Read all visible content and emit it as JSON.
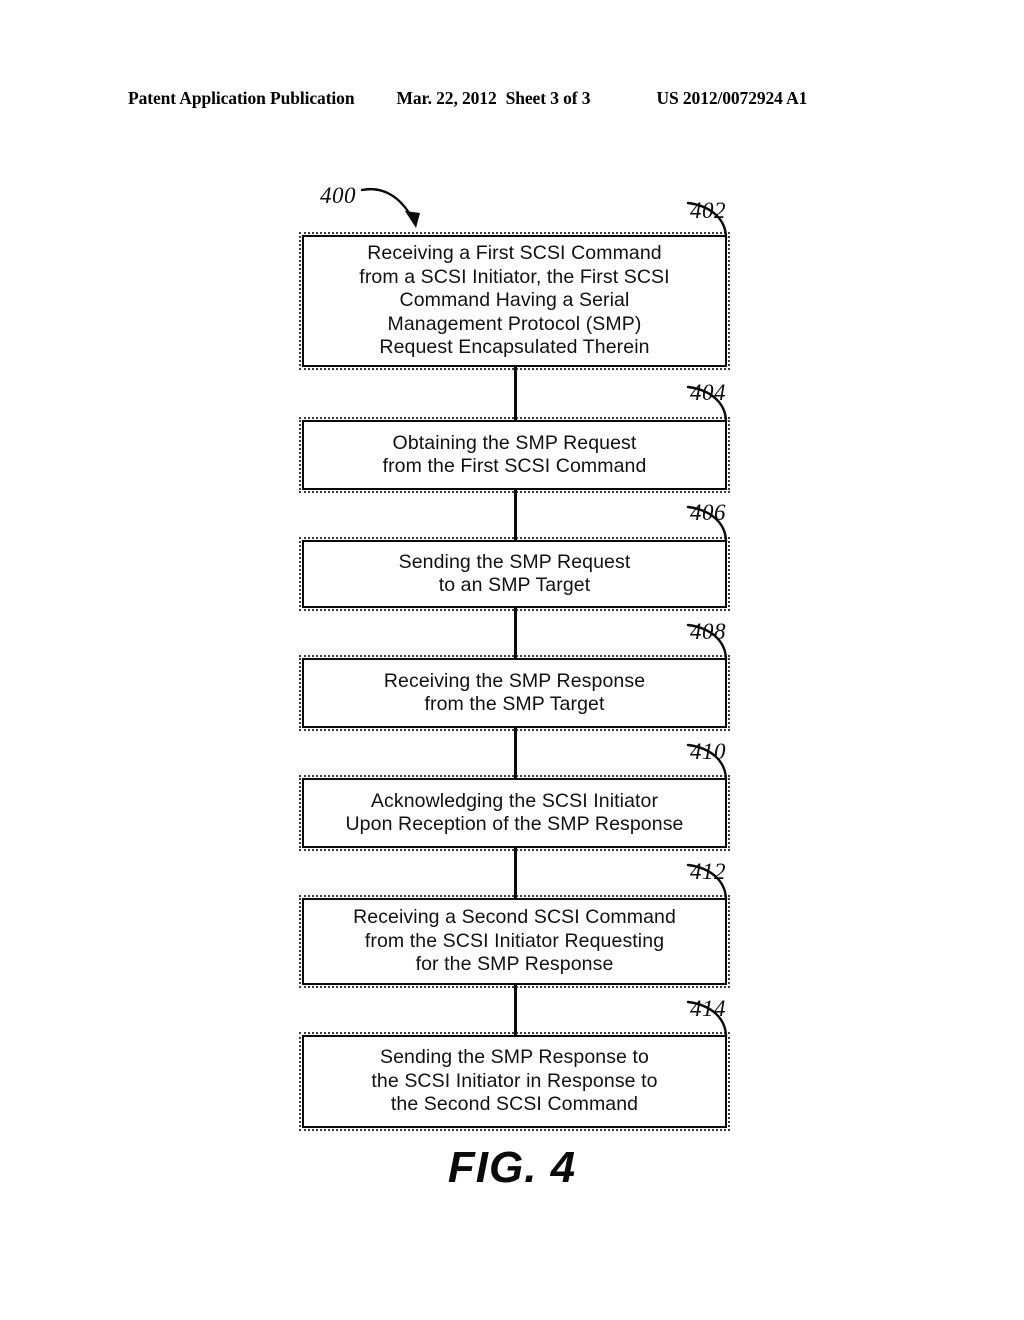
{
  "header": {
    "publication": "Patent Application Publication",
    "date": "Mar. 22, 2012",
    "sheet": "Sheet 3 of 3",
    "patent_number": "US 2012/0072924 A1"
  },
  "figure": {
    "flow_label": "400",
    "caption": "FIG. 4",
    "steps": [
      {
        "ref": "402",
        "text": "Receiving a First SCSI Command\nfrom a SCSI Initiator, the First SCSI\nCommand Having a Serial\nManagement Protocol (SMP)\nRequest Encapsulated Therein"
      },
      {
        "ref": "404",
        "text": "Obtaining the SMP Request\nfrom the First SCSI Command"
      },
      {
        "ref": "406",
        "text": "Sending the SMP Request\nto an SMP Target"
      },
      {
        "ref": "408",
        "text": "Receiving the SMP Response\nfrom the SMP Target"
      },
      {
        "ref": "410",
        "text": "Acknowledging the SCSI Initiator\nUpon Reception of the SMP Response"
      },
      {
        "ref": "412",
        "text": "Receiving a Second SCSI Command\nfrom the SCSI Initiator Requesting\nfor the SMP Response"
      },
      {
        "ref": "414",
        "text": "Sending the SMP Response to\nthe SCSI Initiator in Response to\nthe Second SCSI Command"
      }
    ]
  },
  "colors": {
    "ink": "#0a0a0a",
    "paper": "#ffffff"
  }
}
